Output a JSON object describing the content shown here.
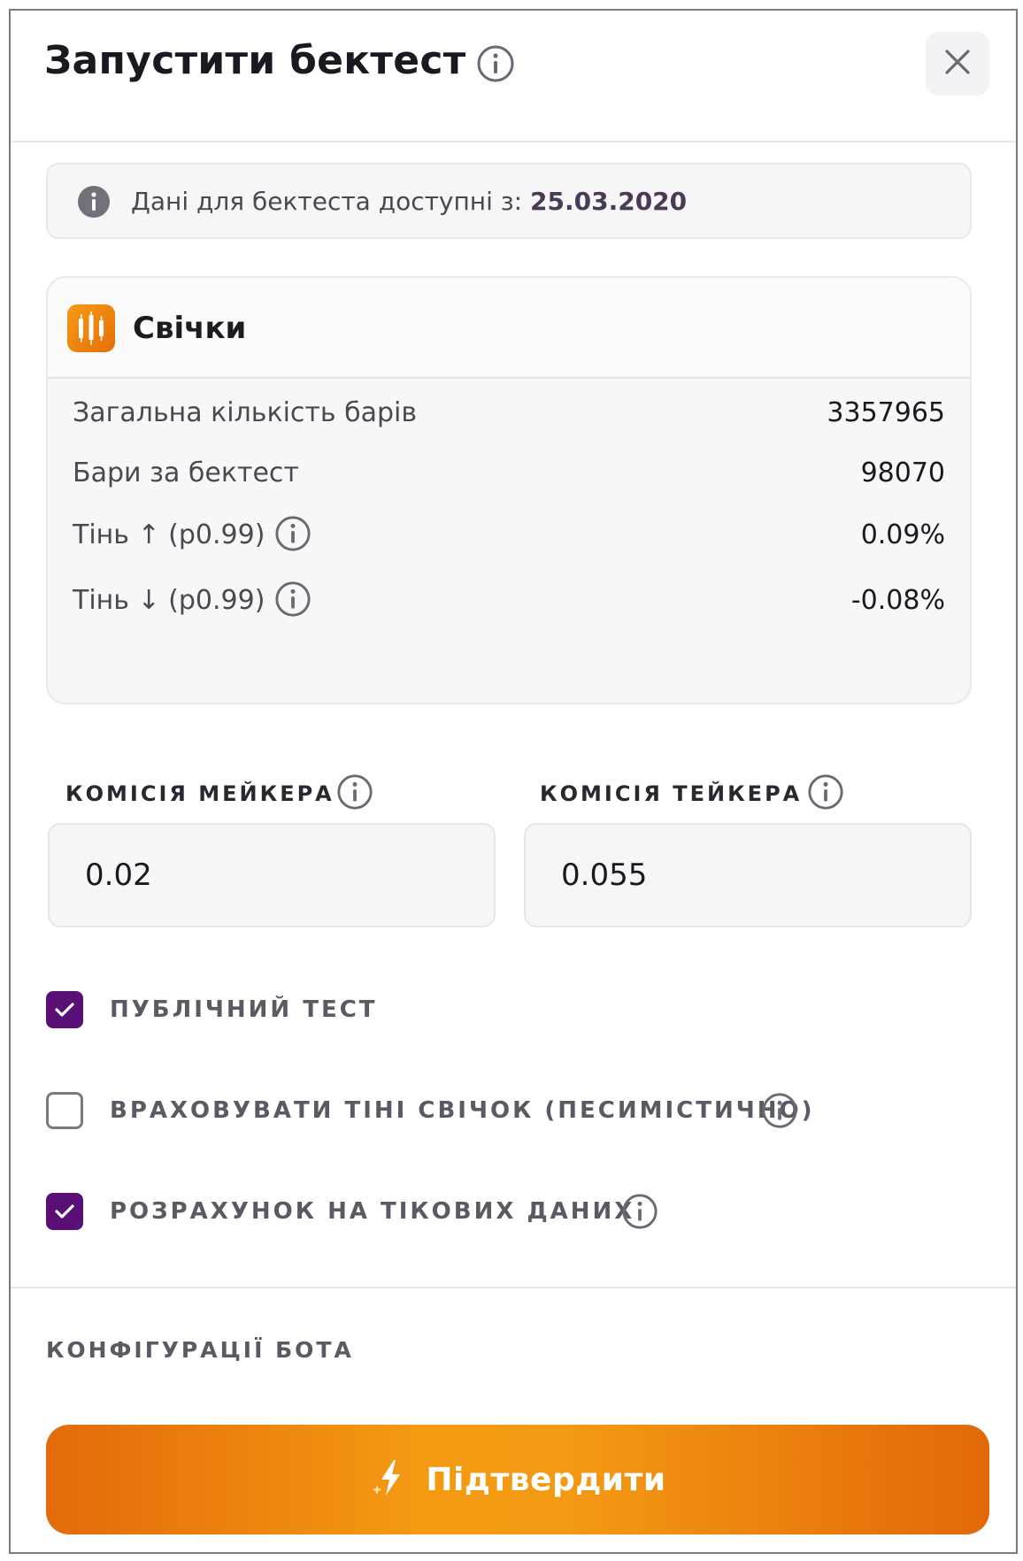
{
  "header": {
    "title": "Запустити бектест"
  },
  "notice": {
    "text": "Дані для бектеста доступні з:",
    "date": "25.03.2020"
  },
  "candles": {
    "title": "Свічки",
    "rows": [
      {
        "label": "Загальна кількість барів",
        "value": "3357965"
      },
      {
        "label": "Бари за бектест",
        "value": "98070"
      },
      {
        "label": "Тінь ↑ (p0.99)",
        "value": "0.09%"
      },
      {
        "label": "Тінь ↓ (p0.99)",
        "value": "-0.08%"
      }
    ]
  },
  "commissions": {
    "maker_label": "КОМІСІЯ МЕЙКЕРА",
    "maker_value": "0.02",
    "taker_label": "КОМІСІЯ ТЕЙКЕРА",
    "taker_value": "0.055"
  },
  "options": [
    {
      "label": "ПУБЛІЧНИЙ ТЕСТ",
      "checked": true
    },
    {
      "label": "ВРАХОВУВАТИ ТІНІ СВІЧОК (ПЕСИМІСТИЧНО)",
      "checked": false
    },
    {
      "label": "РОЗРАХУНОК НА ТІКОВИХ ДАНИХ",
      "checked": true
    }
  ],
  "config": {
    "label": "КОНФІГУРАЦІЇ БОТА"
  },
  "confirm": {
    "label": "Підтвердити"
  },
  "colors": {
    "accent_purple": "#5a0f77",
    "accent_orange": "#f39a14"
  },
  "icons": {
    "close": "close-icon",
    "info": "info-icon",
    "candles": "candlestick-icon",
    "bolt": "lightning-icon"
  }
}
